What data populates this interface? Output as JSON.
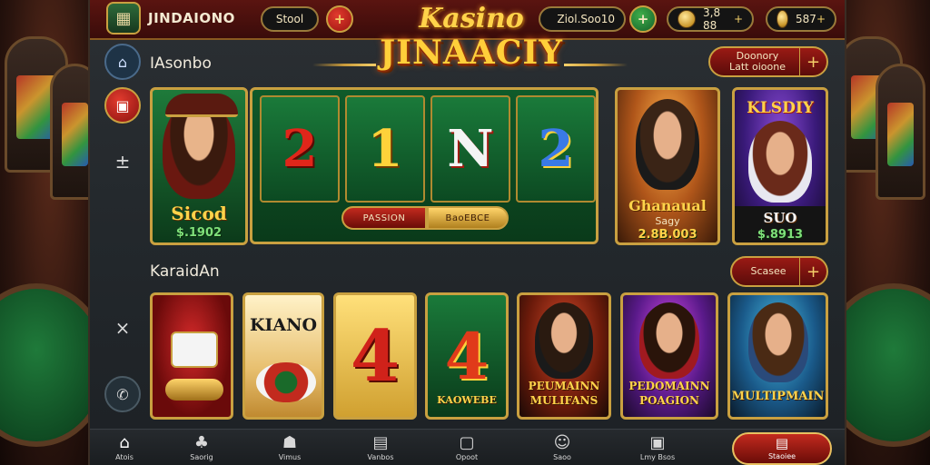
{
  "header": {
    "app_name": "JINDAIONO",
    "app_icon": "grid-icon",
    "stool_label": "Stool",
    "add_symbol": "+",
    "balance_1": "Ziol.Soo10",
    "balance_1_icon": "gem-icon",
    "balance_1_action": "+",
    "balance_2": "3,8 88",
    "balance_2_action": "+",
    "balance_3": "587",
    "balance_3_action": "+"
  },
  "logo": {
    "line1": "Kasino",
    "line2": "JINAACIY"
  },
  "rail": {
    "top_icon": "bank-icon",
    "second_icon": "gift-icon",
    "third_icon": "up-icon",
    "fourth_icon": "close-icon",
    "fifth_icon": "phone-icon"
  },
  "featured": {
    "title": "IAsonbo",
    "action_label": "Doonory\nLatt oioone",
    "action_plus": "+",
    "card1": {
      "name": "Sicod",
      "amount": "$.1902"
    },
    "reels": [
      "2",
      "1",
      "N",
      "2"
    ],
    "reel_btn_red": "PASSION",
    "reel_btn_gold": "BaoEBCE",
    "card2": {
      "name": "Ghanaual",
      "sub": "Sagy",
      "amount": "2.8B.003"
    },
    "card3": {
      "badge": "KLSDIY",
      "name": "SUO",
      "amount": "$.8913"
    }
  },
  "games": {
    "title": "KaraidAn",
    "action_label": "Scasee",
    "action_plus": "+",
    "tiles": [
      {
        "big": "",
        "cap": ""
      },
      {
        "big": "KIANO",
        "cap": ""
      },
      {
        "big": "4",
        "cap": ""
      },
      {
        "big": "4",
        "cap": "KAOWEBE"
      },
      {
        "big": "",
        "cap": "PEUMAINN\nMULIFANS"
      },
      {
        "big": "",
        "cap": "PEDOMAINN\nPOAGION"
      },
      {
        "big": "",
        "cap": "MULTIPMAIN"
      }
    ]
  },
  "nav": {
    "items": [
      {
        "icon": "home-icon",
        "label": "Atois"
      },
      {
        "icon": "slots-icon",
        "label": "Saorig"
      },
      {
        "icon": "people-icon",
        "label": "Vimus"
      },
      {
        "icon": "box-icon",
        "label": "Vanbos"
      },
      {
        "icon": "square-icon",
        "label": "Opoot"
      },
      {
        "icon": "chat-icon",
        "label": "Saoo"
      },
      {
        "icon": "calendar-icon",
        "label": "Lmy Bsos"
      }
    ],
    "cta": {
      "icon": "cash-icon",
      "label": "Staoiee"
    }
  }
}
